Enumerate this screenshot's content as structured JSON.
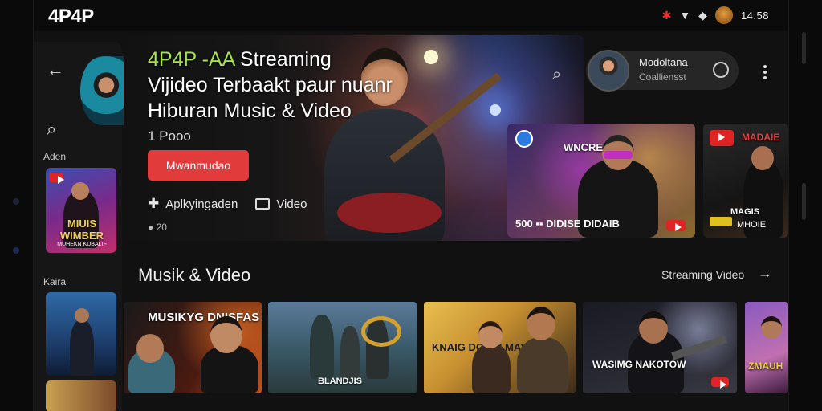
{
  "status_bar": {
    "brand": "4P4P",
    "icons": [
      "flower-icon",
      "signal-icon",
      "wifi-icon",
      "avatar"
    ],
    "clock": "14:58"
  },
  "rail": {
    "label_1": "Aden",
    "label_2": "Kaira",
    "thumb_1_caption": "MIUIS WIMBER",
    "thumb_1_sub": "MUHEKN KUBALIF"
  },
  "hero": {
    "title_accent": "4P4P -AA",
    "title_rest_1": " Streaming",
    "title_line_2": "Vijideo Terbaakt paur nuanr",
    "title_line_3": "Hiburan Music & Video",
    "subtitle": "1 Pooo",
    "button_label": "Mwanmudao",
    "meta_app": "Aplkyingaden",
    "meta_video": "Video",
    "location": "● 20"
  },
  "profile": {
    "name": "Modoltana",
    "subtitle": "Coalliensst"
  },
  "featured": [
    {
      "title": "WNCRE",
      "footer": "500  ▪▪ DIDISE DIDAIB"
    },
    {
      "title": "MADAIE",
      "sub": "MAGIS",
      "footer": "MHOIE"
    }
  ],
  "section": {
    "title": "Musik & Video",
    "link": "Streaming Video"
  },
  "row": [
    {
      "caption": "MUSIKYG DNISFAS"
    },
    {
      "caption": "BLANDJIS"
    },
    {
      "caption": "KNAIG DOUUI MAYDIAN"
    },
    {
      "caption": "WASIMG NAKOTOW"
    },
    {
      "caption": "ZMAUH"
    }
  ],
  "colors": {
    "accent_green": "#a7e24f",
    "button_red": "#e23b3b",
    "background": "#111111"
  }
}
